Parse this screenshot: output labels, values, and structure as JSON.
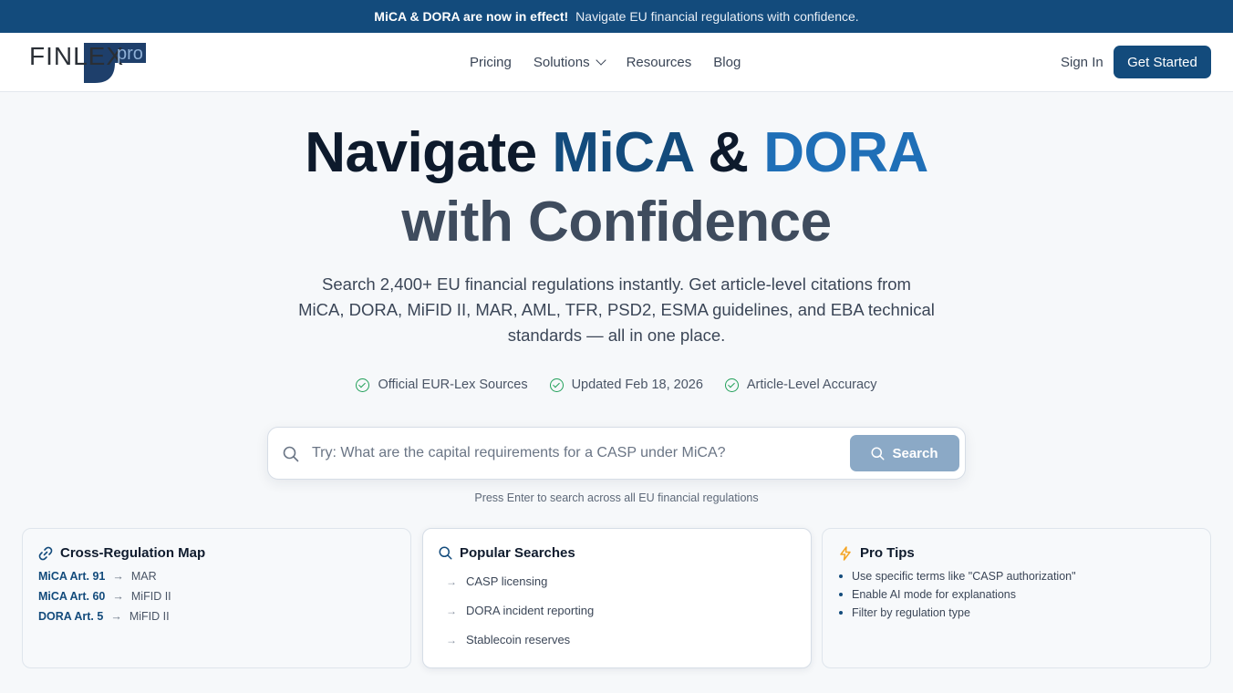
{
  "banner": {
    "bold": "MiCA & DORA are now in effect!",
    "text": "Navigate EU financial regulations with confidence."
  },
  "logo": {
    "word": "FINLEX",
    "suffix": "pro"
  },
  "nav": {
    "links": [
      "Pricing",
      "Solutions",
      "Resources",
      "Blog"
    ],
    "sign_in": "Sign In",
    "get_started": "Get Started"
  },
  "hero": {
    "title_part1": "Navigate ",
    "title_mica": "MiCA",
    "title_amp": " & ",
    "title_dora": "DORA",
    "title_line2": "with Confidence",
    "subtitle": "Search 2,400+ EU financial regulations instantly. Get article-level citations from MiCA, DORA, MiFID II, MAR, AML, TFR, PSD2, ESMA guidelines, and EBA technical standards — all in one place."
  },
  "badges": [
    "Official EUR-Lex Sources",
    "Updated Feb 18, 2026",
    "Article-Level Accuracy"
  ],
  "search": {
    "placeholder": "Try: What are the capital requirements for a CASP under MiCA?",
    "button": "Search",
    "hint": "Press Enter to search across all EU financial regulations"
  },
  "cards": {
    "map": {
      "title": "Cross-Regulation Map",
      "rows": [
        {
          "from": "MiCA Art. 91",
          "to": "MAR"
        },
        {
          "from": "MiCA Art. 60",
          "to": "MiFID II"
        },
        {
          "from": "DORA Art. 5",
          "to": "MiFID II"
        }
      ]
    },
    "popular": {
      "title": "Popular Searches",
      "items": [
        "CASP licensing",
        "DORA incident reporting",
        "Stablecoin reserves"
      ]
    },
    "tips": {
      "title": "Pro Tips",
      "items": [
        "Use specific terms like \"CASP authorization\"",
        "Enable AI mode for explanations",
        "Filter by regulation type"
      ]
    }
  },
  "colors": {
    "primary": "#134b7c",
    "accent_blue": "#1f6fb7",
    "check_green": "#22a05a",
    "bolt_orange": "#f5a524"
  }
}
